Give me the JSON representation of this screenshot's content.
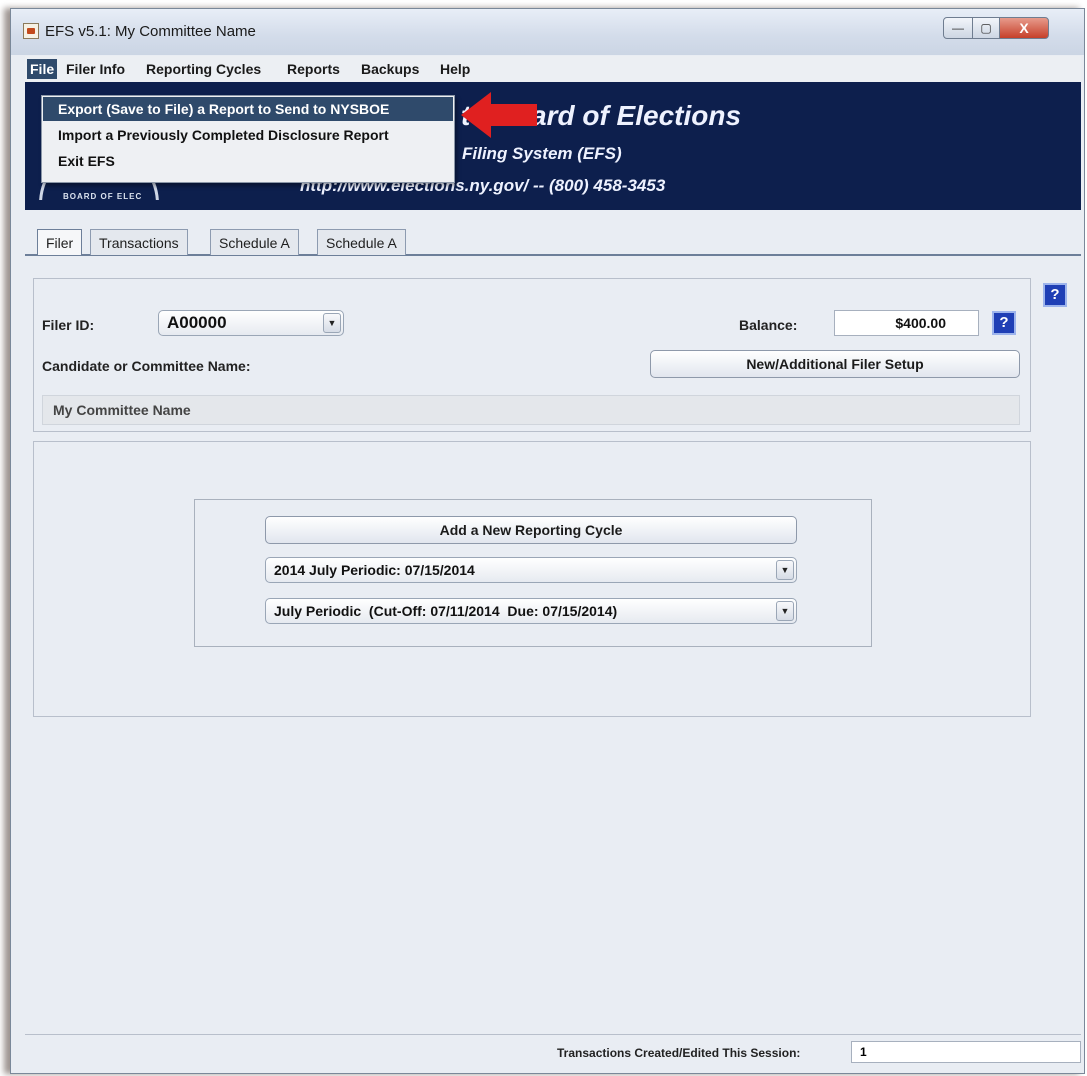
{
  "window": {
    "title": "EFS v5.1: My Committee Name",
    "minimize": "—",
    "maximize": "▢",
    "close": "X"
  },
  "menu": {
    "items": [
      "File",
      "Filer Info",
      "Reporting Cycles",
      "Reports",
      "Backups",
      "Help"
    ],
    "active": "File"
  },
  "file_menu": {
    "items": [
      "Export (Save to File) a Report to Send to NYSBOE",
      "Import a Previously Completed Disclosure Report",
      "Exit EFS"
    ]
  },
  "banner": {
    "title": "te Board of Elections",
    "subtitle": "Filing System (EFS)",
    "url_phone": "http://www.elections.ny.gov/ -- (800) 458-3453",
    "seal_text": "BOARD OF ELEC"
  },
  "tabs": [
    "Filer",
    "Transactions",
    "Schedule A",
    "Schedule A"
  ],
  "filer": {
    "filer_id_label": "Filer ID:",
    "filer_id_value": "A00000",
    "balance_label": "Balance:",
    "balance_value": "$400.00",
    "name_label": "Candidate or Committee Name:",
    "setup_button": "New/Additional Filer Setup",
    "committee_name": "My Committee Name",
    "help": "?"
  },
  "cycle": {
    "add_button": "Add a New Reporting Cycle",
    "cycle_select": "2014 July Periodic: 07/15/2014",
    "period_select": "July Periodic  (Cut-Off: 07/11/2014  Due: 07/15/2014)"
  },
  "status": {
    "label": "Transactions Created/Edited This Session:",
    "value": "1"
  },
  "colors": {
    "banner": "#0d1f4d",
    "menu_highlight": "#2f4a6b",
    "help_button": "#1f3fb5",
    "annotation_arrow": "#e02020"
  }
}
